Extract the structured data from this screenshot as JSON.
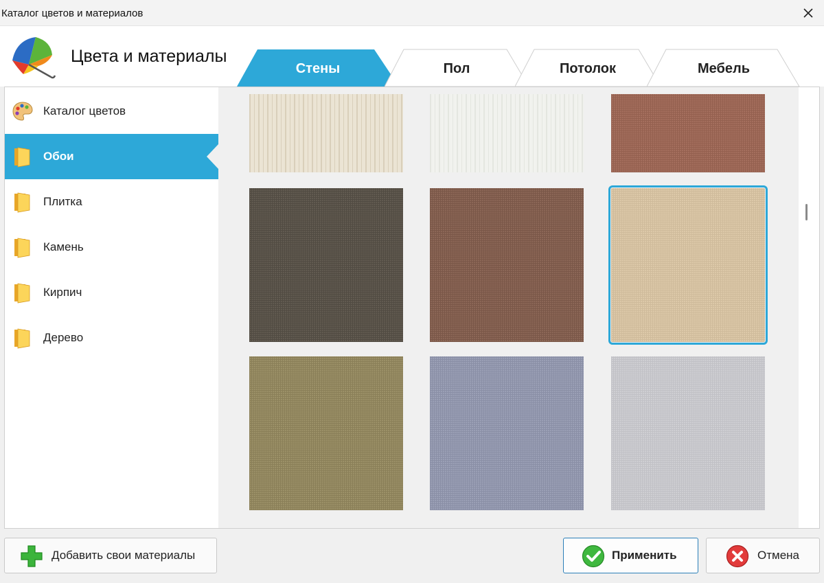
{
  "window": {
    "title": "Каталог цветов и материалов",
    "close_icon": "close-icon"
  },
  "header": {
    "title": "Цвета и материалы"
  },
  "tabs": [
    {
      "label": "Стены",
      "active": true
    },
    {
      "label": "Пол",
      "active": false
    },
    {
      "label": "Потолок",
      "active": false
    },
    {
      "label": "Мебель",
      "active": false
    }
  ],
  "sidebar": {
    "items": [
      {
        "label": "Каталог цветов",
        "icon": "palette-icon",
        "active": false
      },
      {
        "label": "Обои",
        "icon": "folder-icon",
        "active": true
      },
      {
        "label": "Плитка",
        "icon": "folder-icon",
        "active": false
      },
      {
        "label": "Камень",
        "icon": "folder-icon",
        "active": false
      },
      {
        "label": "Кирпич",
        "icon": "folder-icon",
        "active": false
      },
      {
        "label": "Дерево",
        "icon": "folder-icon",
        "active": false
      }
    ]
  },
  "swatches": [
    {
      "color": "#ebe4d4",
      "stripe": "#d9cfba",
      "pattern": "stripes",
      "selected": false
    },
    {
      "color": "#f1f2ee",
      "stripe": "#e4e6e0",
      "pattern": "stripes",
      "selected": false
    },
    {
      "color": "#a56f5e",
      "stripe": "#94604f",
      "pattern": "linen",
      "selected": false
    },
    {
      "color": "#625b51",
      "stripe": "#514b42",
      "pattern": "linen",
      "selected": false
    },
    {
      "color": "#8c6757",
      "stripe": "#7a5748",
      "pattern": "linen",
      "selected": false
    },
    {
      "color": "#ddc9a9",
      "stripe": "#cfbb9b",
      "pattern": "linen",
      "selected": true
    },
    {
      "color": "#9c9168",
      "stripe": "#8a7f58",
      "pattern": "linen",
      "selected": false
    },
    {
      "color": "#9ba0b6",
      "stripe": "#8a8fa6",
      "pattern": "linen",
      "selected": false
    },
    {
      "color": "#cfcfd3",
      "stripe": "#c1c1c6",
      "pattern": "linen",
      "selected": false
    }
  ],
  "footer": {
    "add_label": "Добавить свои материалы",
    "apply_label": "Применить",
    "cancel_label": "Отмена"
  },
  "colors": {
    "accent": "#2da8d8"
  }
}
